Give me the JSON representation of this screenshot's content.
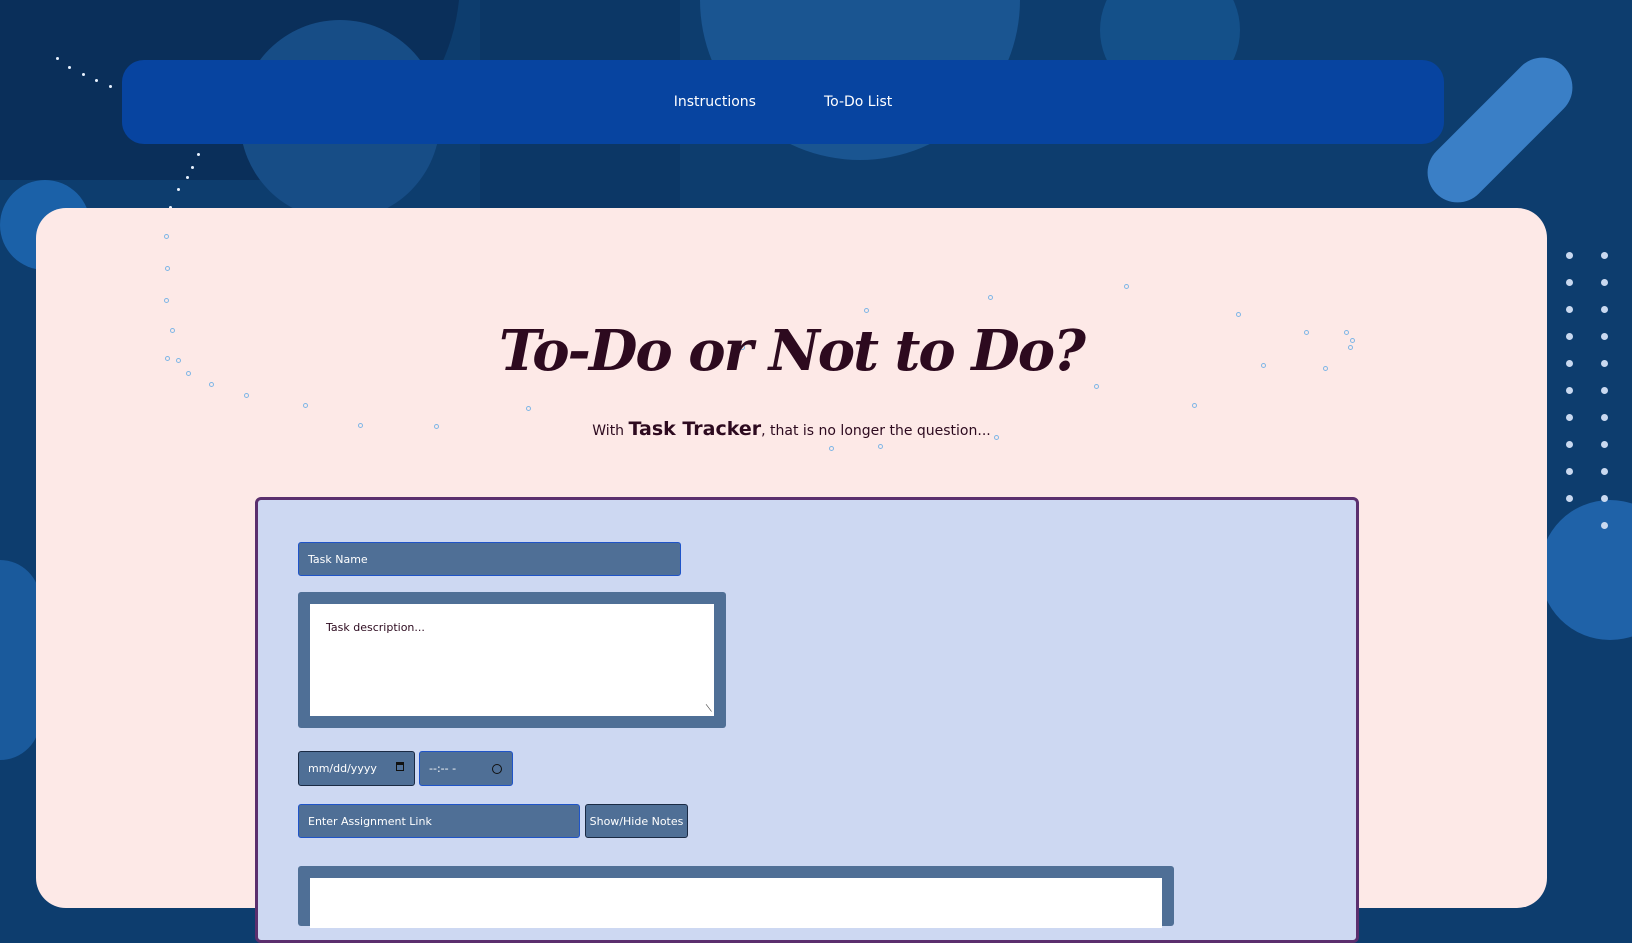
{
  "nav": {
    "items": [
      "Instructions",
      "To-Do List"
    ]
  },
  "hero": {
    "title": "To-Do or Not to Do?",
    "subtitle_prefix": "With ",
    "brand": "Task Tracker",
    "subtitle_suffix": ", that is no longer the question..."
  },
  "form": {
    "task_name_placeholder": "Task Name",
    "description_placeholder": "Task description...",
    "date_placeholder": "mm/dd/yyyy",
    "time_placeholder": "--:-- -",
    "link_placeholder": "Enter Assignment Link",
    "notes_button": "Show/Hide Notes"
  },
  "colors": {
    "background": "#0d3d6e",
    "nav": "#0744a0",
    "card": "#fde9e7",
    "panel": "#cdd8f2",
    "field": "#4f6f96",
    "panel_border": "#5b2f6e",
    "title": "#2d0a1f"
  },
  "icons": [
    "calendar-icon",
    "clock-icon",
    "resize-handle-icon"
  ]
}
